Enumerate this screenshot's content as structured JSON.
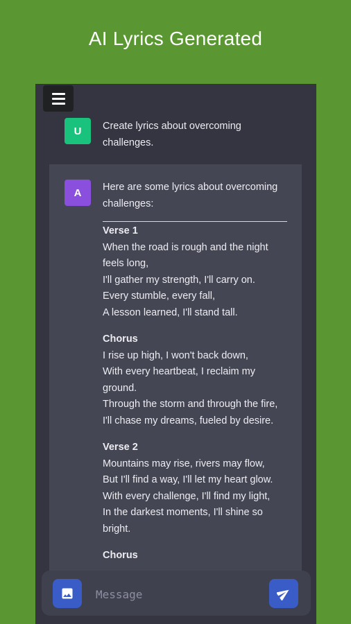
{
  "header": {
    "title": "AI Lyrics Generated"
  },
  "conversation": {
    "user": {
      "avatar_letter": "U",
      "text": "Create lyrics about overcoming challenges."
    },
    "assistant": {
      "avatar_letter": "A",
      "intro": "Here are some lyrics about overcoming challenges:",
      "sections": [
        {
          "title": "Verse 1",
          "lines": [
            "When the road is rough and the night feels long,",
            "I'll gather my strength, I'll carry on.",
            "Every stumble, every fall,",
            "A lesson learned, I'll stand tall."
          ]
        },
        {
          "title": "Chorus",
          "lines": [
            "I rise up high, I won't back down,",
            "With every heartbeat, I reclaim my ground.",
            "Through the storm and through the fire,",
            "I'll chase my dreams, fueled by desire."
          ]
        },
        {
          "title": "Verse 2",
          "lines": [
            "Mountains may rise, rivers may flow,",
            "But I'll find a way, I'll let my heart glow.",
            "With every challenge, I'll find my light,",
            "In the darkest moments, I'll shine so bright."
          ]
        },
        {
          "title": "Chorus",
          "lines": []
        }
      ]
    }
  },
  "composer": {
    "placeholder": "Message",
    "value": ""
  },
  "icons": {
    "menu": "hamburger-menu-icon",
    "image": "image-icon",
    "send": "send-icon"
  },
  "colors": {
    "background": "#5a9732",
    "chat_bg": "#343541",
    "assistant_bubble": "#444654",
    "user_avatar": "#19c37d",
    "assistant_avatar": "#8a4fdc",
    "button_blue": "#3a5cc7"
  }
}
